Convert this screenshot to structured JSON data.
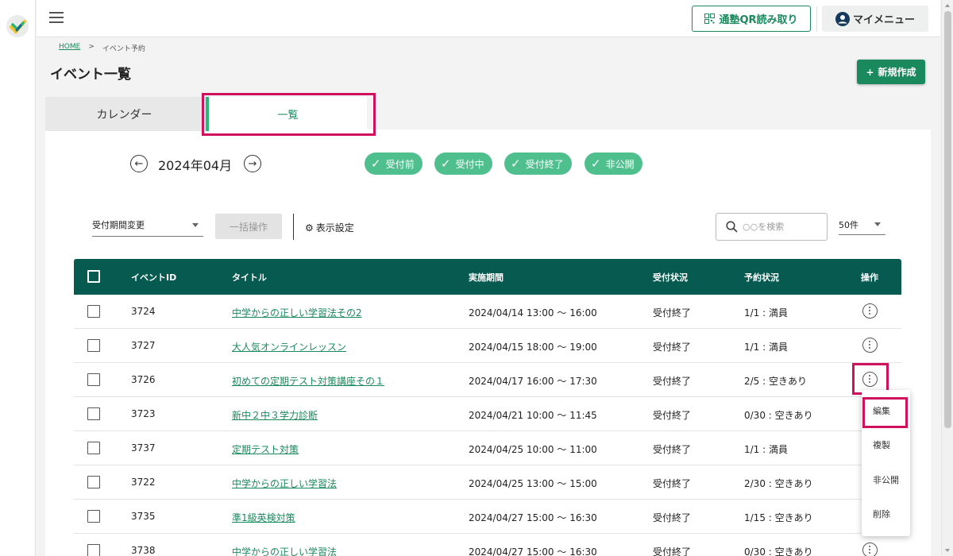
{
  "header": {
    "qr_button": "通塾QR読み取り",
    "mymenu_button": "マイメニュー"
  },
  "breadcrumb": {
    "home": "HOME",
    "separator": ">",
    "current": "イベント予約"
  },
  "page": {
    "title": "イベント一覧",
    "new_button": "新規作成"
  },
  "tabs": [
    {
      "label": "カレンダー",
      "active": false
    },
    {
      "label": "一覧",
      "active": true
    }
  ],
  "month": {
    "label": "2024年04月"
  },
  "filters": [
    {
      "label": "受付前",
      "checked": true
    },
    {
      "label": "受付中",
      "checked": true
    },
    {
      "label": "受付終了",
      "checked": true
    },
    {
      "label": "非公開",
      "checked": true
    }
  ],
  "toolbar": {
    "period_select": "受付期間変更",
    "bulk_button": "一括操作",
    "display_settings": "表示設定",
    "search_placeholder": "○○を検索",
    "per_page": "50件"
  },
  "table": {
    "headers": [
      "イベントID",
      "タイトル",
      "実施期間",
      "受付状況",
      "予約状況",
      "操作"
    ],
    "rows": [
      {
        "id": "3724",
        "title": "中学からの正しい学習法その2",
        "period": "2024/04/14 13:00 ～ 16:00",
        "status": "受付終了",
        "reservation": "1/1 : 満員"
      },
      {
        "id": "3727",
        "title": "大人気オンラインレッスン",
        "period": "2024/04/15 18:00 ～ 19:00",
        "status": "受付終了",
        "reservation": "1/1 : 満員"
      },
      {
        "id": "3726",
        "title": "初めての定期テスト対策講座その１",
        "period": "2024/04/17 16:00 ～ 17:30",
        "status": "受付終了",
        "reservation": "2/5 : 空きあり"
      },
      {
        "id": "3723",
        "title": "新中２中３学力診断",
        "period": "2024/04/21 10:00 ～ 11:45",
        "status": "受付終了",
        "reservation": "0/30 : 空きあり"
      },
      {
        "id": "3737",
        "title": "定期テスト対策",
        "period": "2024/04/25 10:00 ～ 11:00",
        "status": "受付終了",
        "reservation": "1/1 : 満員"
      },
      {
        "id": "3722",
        "title": "中学からの正しい学習法",
        "period": "2024/04/25 13:00 ～ 15:00",
        "status": "受付終了",
        "reservation": "2/30 : 空きあり"
      },
      {
        "id": "3735",
        "title": "準1級英検対策",
        "period": "2024/04/27 15:00 ～ 16:30",
        "status": "受付終了",
        "reservation": "1/15 : 空きあり"
      },
      {
        "id": "3738",
        "title": "中学からの正しい学習法",
        "period": "2024/04/27 15:00 ～ 16:30",
        "status": "受付終了",
        "reservation": "0/30 : 空きあり"
      }
    ]
  },
  "context_menu": {
    "items": [
      "編集",
      "複製",
      "非公開",
      "削除"
    ]
  },
  "colors": {
    "brand_green": "#1a8a5e",
    "header_dark_green": "#065a4f",
    "chip_green": "#4fc08d",
    "highlight_magenta": "#d0115d"
  }
}
